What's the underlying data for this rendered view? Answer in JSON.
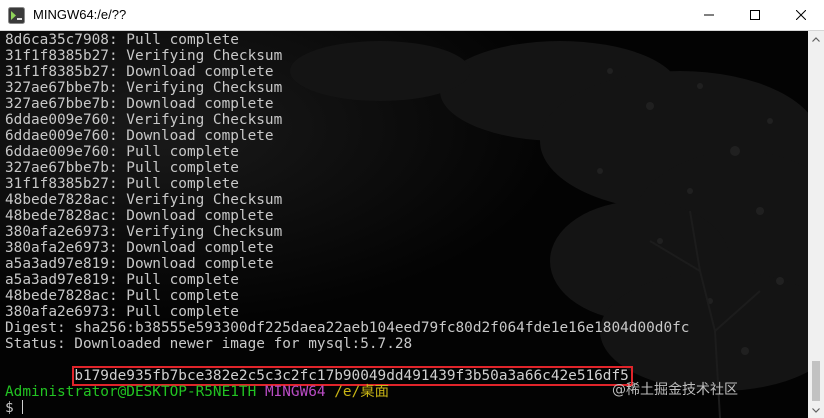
{
  "window": {
    "title": "MINGW64:/e/??",
    "icon": "mingw-terminal-icon",
    "buttons": {
      "minimize_icon": "minimize-icon",
      "maximize_icon": "maximize-icon",
      "close_icon": "close-icon"
    }
  },
  "terminal": {
    "log_lines": [
      "8d6ca35c7908: Pull complete",
      "31f1f8385b27: Verifying Checksum",
      "31f1f8385b27: Download complete",
      "327ae67bbe7b: Verifying Checksum",
      "327ae67bbe7b: Download complete",
      "6ddae009e760: Verifying Checksum",
      "6ddae009e760: Download complete",
      "6ddae009e760: Pull complete",
      "327ae67bbe7b: Pull complete",
      "31f1f8385b27: Pull complete",
      "48bede7828ac: Verifying Checksum",
      "48bede7828ac: Download complete",
      "380afa2e6973: Verifying Checksum",
      "380afa2e6973: Download complete",
      "a5a3ad97e819: Download complete",
      "a5a3ad97e819: Pull complete",
      "48bede7828ac: Pull complete",
      "380afa2e6973: Pull complete",
      "Digest: sha256:b38555e593300df225daea22aeb104eed79fc80d2f064fde1e16e1804d00d0fc",
      "Status: Downloaded newer image for mysql:5.7.28"
    ],
    "image_id": "b179de935fb7bce382e2c5c3c2fc17b90049dd491439f3b50a3a66c42e516df5",
    "prompt": {
      "user_host": "Administrator@DESKTOP-R5NE1TH",
      "system": "MINGW64",
      "path": "/e/桌面",
      "symbol": "$"
    },
    "colors": {
      "text": "#c8c8c8",
      "user_host": "#22c322",
      "system": "#b94cc4",
      "path": "#c9b515",
      "highlight_box": "#e0242a",
      "background": "#030303"
    }
  },
  "watermark": {
    "text": "@稀土掘金技术社区"
  }
}
